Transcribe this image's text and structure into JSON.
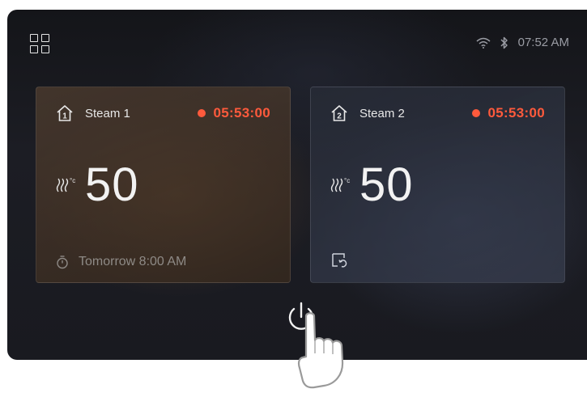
{
  "status_bar": {
    "time": "07:52 AM",
    "icons": [
      "wifi-icon",
      "bluetooth-icon"
    ]
  },
  "menu_icon": "grid-menu-icon",
  "cards": [
    {
      "slot_number": "1",
      "name": "Steam 1",
      "timer": "05:53:00",
      "temperature": "50",
      "temperature_unit": "°c",
      "footer_text": "Tomorrow 8:00 AM",
      "footer_icon": "stopwatch-icon"
    },
    {
      "slot_number": "2",
      "name": "Steam 2",
      "timer": "05:53:00",
      "temperature": "50",
      "temperature_unit": "°c",
      "footer_text": "",
      "footer_icon": "water-refill-icon"
    }
  ],
  "colors": {
    "accent_timer": "#ff5a3c",
    "text_primary": "#f2f2f2",
    "status_text": "#9a9ca4"
  },
  "power_button_icon": "power-icon",
  "cursor_icon": "pointing-hand-icon"
}
